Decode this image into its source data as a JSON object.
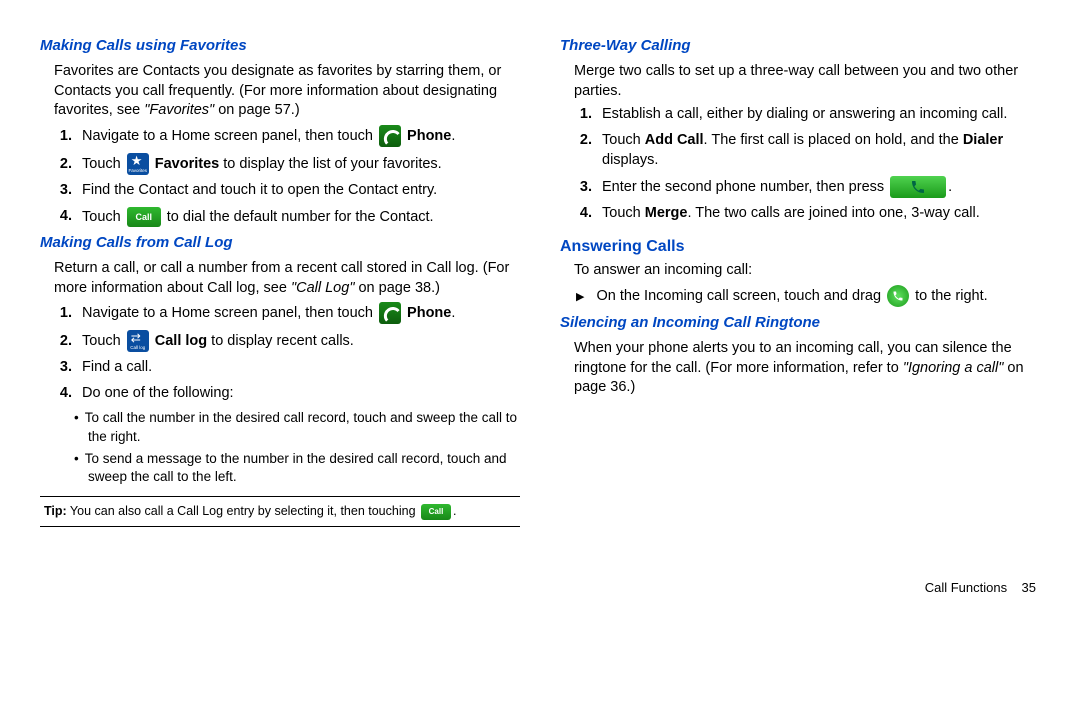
{
  "col1": {
    "h1": "Making Calls using Favorites",
    "p1a": "Favorites are Contacts you designate as favorites by starring them, or Contacts you call frequently. (For more information about designating favorites, see ",
    "p1b": "\"Favorites\"",
    "p1c": " on page 57.)",
    "s1_1a": "Navigate to a Home screen panel, then touch ",
    "s1_1b": "Phone",
    "s1_1c": ".",
    "s1_2a": "Touch ",
    "s1_2b": "Favorites",
    "s1_2c": " to display the list of your favorites.",
    "s1_3": "Find the Contact and touch it to open the Contact entry.",
    "s1_4a": "Touch ",
    "s1_4b": " to dial the default number for the Contact.",
    "h2": "Making Calls from Call Log",
    "p2a": "Return a call, or call a number from a recent call stored in Call log. (For more information about Call log, see ",
    "p2b": "\"Call Log\"",
    "p2c": " on page 38.)",
    "s2_1a": "Navigate to a Home screen panel, then touch ",
    "s2_1b": "Phone",
    "s2_1c": ".",
    "s2_2a": "Touch ",
    "s2_2b": "Call log",
    "s2_2c": " to display recent calls.",
    "s2_3": "Find a call.",
    "s2_4": "Do one of the following:",
    "b1": "To call the number in the desired call record, touch and sweep the call to the right.",
    "b2": "To send a message to the number in the desired call record, touch and sweep the call to the left.",
    "tip_label": "Tip:",
    "tip_text": " You can also call a Call Log entry by selecting it, then touching ",
    "tip_end": "."
  },
  "col2": {
    "h1": "Three-Way Calling",
    "p1": "Merge two calls to set up a three-way call between you and two other parties.",
    "s1_1": "Establish a call, either by dialing or answering an incoming call.",
    "s1_2a": "Touch ",
    "s1_2b": "Add Call",
    "s1_2c": ". The first call is placed on hold, and the ",
    "s1_2d": "Dialer",
    "s1_2e": " displays.",
    "s1_3a": "Enter the second phone number, then press ",
    "s1_3b": ".",
    "s1_4a": "Touch ",
    "s1_4b": "Merge",
    "s1_4c": ". The two calls are joined into one, 3-way call.",
    "h2": "Answering Calls",
    "p2": "To answer an incoming call:",
    "t1a": "On the Incoming call screen, touch and drag ",
    "t1b": " to the right.",
    "h3": "Silencing an Incoming Call Ringtone",
    "p3a": "When your phone alerts you to an incoming call, you can silence the ringtone for the call. (For more information, refer to ",
    "p3b": "\"Ignoring a call\"",
    "p3c": " on page 36.)"
  },
  "footer": {
    "section": "Call Functions",
    "page": "35"
  },
  "icons": {
    "call_label": "Call"
  }
}
